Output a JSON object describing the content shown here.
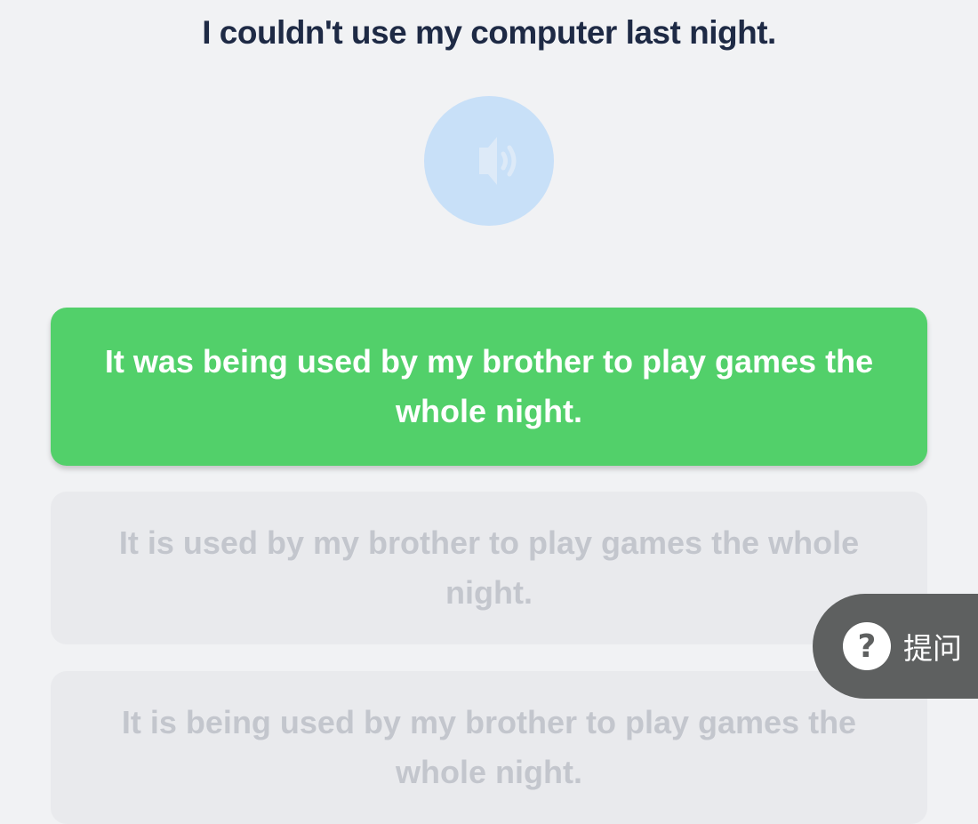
{
  "question": {
    "text": "I couldn't use my computer last night."
  },
  "audio": {
    "icon": "speaker-icon",
    "color": "#c8e0f8"
  },
  "options": [
    {
      "text": "It was being used by my brother to play games the whole night.",
      "state": "correct",
      "color": "#52d06a"
    },
    {
      "text": "It is used by my brother to play games the whole night.",
      "state": "disabled"
    },
    {
      "text": "It is being used by my brother to play games the whole night.",
      "state": "disabled"
    }
  ],
  "hint": {
    "icon": "question-mark-icon",
    "symbol": "?",
    "label": "提问"
  }
}
